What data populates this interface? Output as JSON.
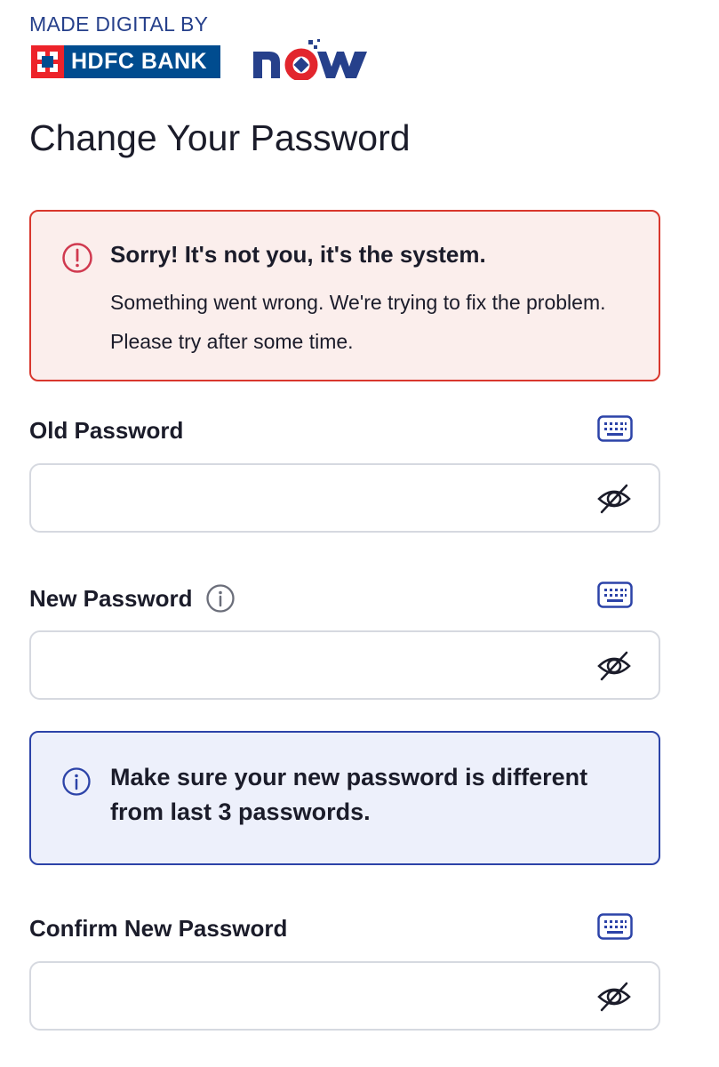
{
  "header": {
    "made_digital_by": "MADE DIGITAL BY",
    "bank_name": "HDFC BANK",
    "partner_logo_text": "NOW"
  },
  "page": {
    "title": "Change Your Password"
  },
  "error_alert": {
    "icon": "exclamation-circle-icon",
    "heading": "Sorry! It's not you, it's the system.",
    "body": "Something went wrong. We're trying to fix the problem. Please try after some time."
  },
  "fields": {
    "old_password": {
      "label": "Old Password",
      "value": "",
      "placeholder": ""
    },
    "new_password": {
      "label": "New Password",
      "value": "",
      "placeholder": ""
    },
    "confirm_password": {
      "label": "Confirm New Password",
      "value": "",
      "placeholder": ""
    }
  },
  "info_alert": {
    "icon": "info-circle-icon",
    "text": "Make sure your new password is different from last 3 passwords."
  },
  "icons": {
    "keyboard": "keyboard-icon",
    "password_visibility": "eye-slash-icon",
    "info": "info-circle-icon"
  },
  "colors": {
    "brand_blue": "#26408b",
    "hdfc_red": "#ed232a",
    "hdfc_blue": "#004c8f",
    "error_border": "#d8372d",
    "error_bg": "#fbeeec",
    "info_border": "#2c43a8",
    "info_bg": "#edf0fb"
  }
}
